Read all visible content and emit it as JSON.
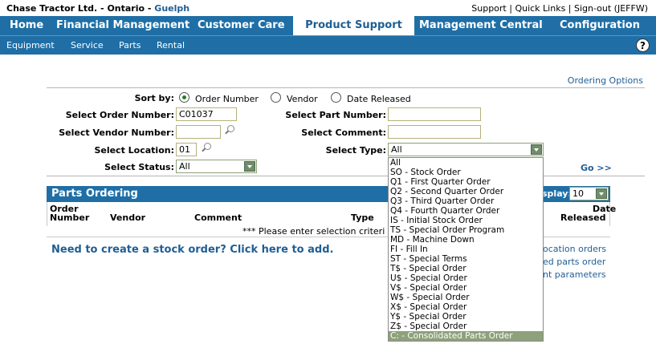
{
  "header": {
    "company": "Chase Tractor Ltd. - Ontario - ",
    "location": "Guelph",
    "links": "Support | Quick Links | Sign-out (JEFFW)"
  },
  "nav": {
    "home": "Home",
    "financial": "Financial Management",
    "customer": "Customer Care",
    "product": "Product Support",
    "management": "Management Central",
    "config": "Configuration"
  },
  "subnav": {
    "equipment": "Equipment",
    "service": "Service",
    "parts": "Parts",
    "rental": "Rental",
    "help": "?"
  },
  "ordering_options": "Ordering Options",
  "sort": {
    "label": "Sort by:",
    "order_number": "Order Number",
    "vendor": "Vendor",
    "date_released": "Date Released",
    "selected": "order_number"
  },
  "form": {
    "order_number_label": "Select Order Number:",
    "order_number_value": "C01037",
    "part_number_label": "Select Part Number:",
    "vendor_number_label": "Select Vendor Number:",
    "comment_label": "Select Comment:",
    "location_label": "Select Location:",
    "location_value": "01",
    "type_label": "Select Type:",
    "type_value": "All",
    "status_label": "Select Status:",
    "status_value": "All",
    "go": "Go >>"
  },
  "panel": {
    "title": "Parts Ordering",
    "display_label": "splay:",
    "display_value": "10",
    "col_order": "Order",
    "col_number": "Number",
    "col_vendor": "Vendor",
    "col_comment": "Comment",
    "col_type": "Type",
    "col_date": "Date",
    "col_released": "Released",
    "no_results": "*** Please enter selection criteri"
  },
  "create_link": "Need to create a stock order? Click here to add.",
  "side_links": {
    "one": "ocation orders",
    "two": "ed parts order",
    "three": "nt parameters"
  },
  "type_options": [
    "All",
    "SO - Stock Order",
    "Q1 - First Quarter Order",
    "Q2 - Second Quarter Order",
    "Q3 - Third Quarter Order",
    "Q4 - Fourth Quarter Order",
    "IS - Initial Stock Order",
    "TS - Special Order Program",
    "MD - Machine Down",
    "FI - Fill In",
    "ST - Special Terms",
    "T$ - Special Order",
    "U$ - Special Order",
    "V$ - Special Order",
    "W$ - Special Order",
    "X$ - Special Order",
    "Y$ - Special Order",
    "Z$ - Special Order",
    "C: - Consolidated Parts Order"
  ],
  "highlighted_option": 18,
  "colors": {
    "nav_blue": "#1f6fa6",
    "link_blue": "#1f5e94",
    "highlight": "#8da17b"
  }
}
